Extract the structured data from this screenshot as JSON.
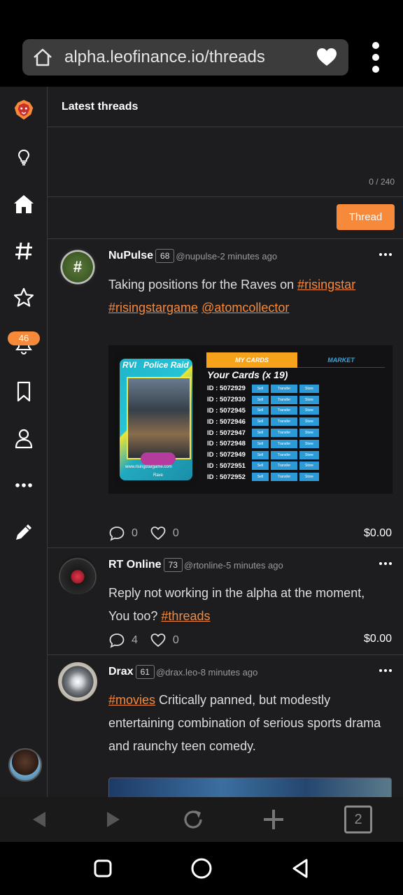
{
  "browser": {
    "url": "alpha.leofinance.io/threads",
    "tab_count": "2"
  },
  "sidebar": {
    "notification_count": "46",
    "items": [
      "logo-icon",
      "ideas-icon",
      "home-icon",
      "hashtag-icon",
      "star-icon",
      "bell-icon",
      "bookmark-icon",
      "profile-icon",
      "more-icon",
      "compose-icon"
    ]
  },
  "feed": {
    "title": "Latest threads",
    "char_counter": "0 / 240",
    "thread_button": "Thread"
  },
  "posts": [
    {
      "author": "NuPulse",
      "reputation": "68",
      "meta": "@nupulse-2 minutes ago",
      "text_before": "Taking positions for the Raves on ",
      "tags": [
        "#risingstar",
        "#risingstargame",
        "@atomcollector"
      ],
      "comments": "0",
      "likes": "0",
      "payout": "$0.00",
      "embed": {
        "card_code": "RVI",
        "card_title": "Police Raid",
        "card_site": "www.risingstargame.com",
        "card_type": "Rave",
        "tab_active": "MY CARDS",
        "tab_other": "MARKET",
        "heading": "Your Cards (x 19)",
        "buttons": [
          "Sell",
          "Transfer",
          "Store"
        ],
        "ids": [
          "ID : 5072929",
          "ID : 5072930",
          "ID : 5072945",
          "ID : 5072946",
          "ID : 5072947",
          "ID : 5072948",
          "ID : 5072949",
          "ID : 5072951",
          "ID : 5072952"
        ]
      }
    },
    {
      "author": "RT Online",
      "reputation": "73",
      "meta": "@rtonline-5 minutes ago",
      "line1": "Reply not working in the alpha at the moment,",
      "line2_before": "You too? ",
      "tag": "#threads",
      "comments": "4",
      "likes": "0",
      "payout": "$0.00"
    },
    {
      "author": "Drax",
      "reputation": "61",
      "meta": "@drax.leo-8 minutes ago",
      "tag": "#movies",
      "text_after_tag": " Critically panned, but modestly",
      "line2": "entertaining combination of serious sports drama",
      "line3": "and raunchy teen comedy."
    }
  ],
  "colors": {
    "accent": "#f6893a",
    "background": "#1d1d1f",
    "border": "#3a3a3a"
  }
}
